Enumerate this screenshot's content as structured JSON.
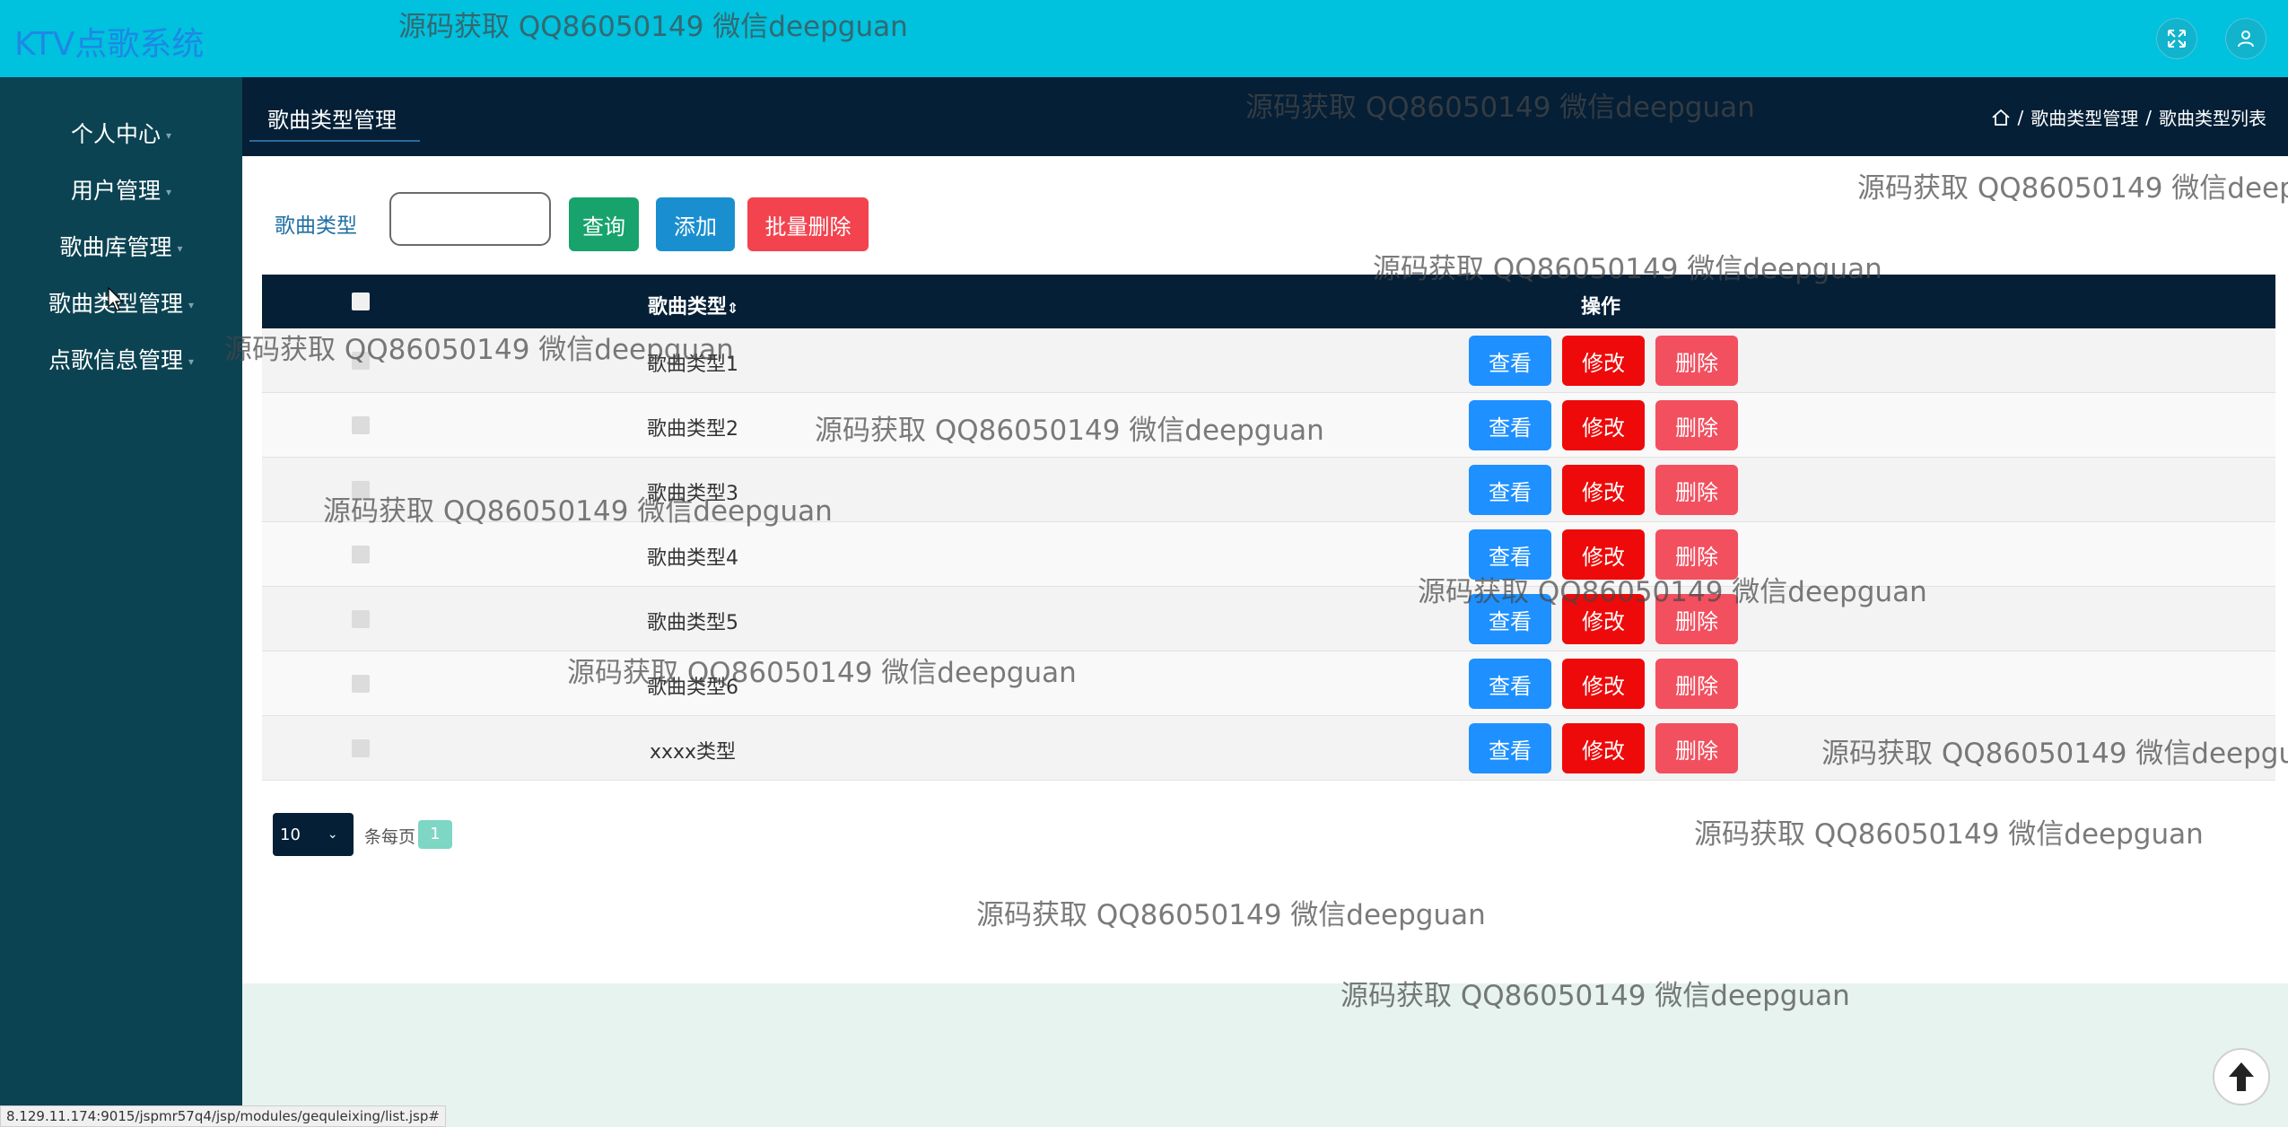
{
  "header": {
    "app_title": "KTV点歌系统",
    "fullscreen_icon": "expand-icon",
    "user_icon": "user-icon"
  },
  "sidebar": {
    "items": [
      {
        "label": "个人中心"
      },
      {
        "label": "用户管理"
      },
      {
        "label": "歌曲库管理"
      },
      {
        "label": "歌曲类型管理"
      },
      {
        "label": "点歌信息管理"
      }
    ]
  },
  "tabbar": {
    "title": "歌曲类型管理",
    "breadcrumb": [
      "歌曲类型管理",
      "歌曲类型列表"
    ],
    "home_icon": "home-icon"
  },
  "search": {
    "label": "歌曲类型",
    "value": "",
    "query_label": "查询",
    "add_label": "添加",
    "batch_delete_label": "批量删除"
  },
  "table": {
    "headers": [
      "歌曲类型",
      "操作"
    ],
    "rows": [
      {
        "name": "歌曲类型1"
      },
      {
        "name": "歌曲类型2"
      },
      {
        "name": "歌曲类型3"
      },
      {
        "name": "歌曲类型4"
      },
      {
        "name": "歌曲类型5"
      },
      {
        "name": "歌曲类型6"
      },
      {
        "name": "xxxx类型"
      }
    ],
    "actions": {
      "view": "查看",
      "edit": "修改",
      "delete": "删除"
    }
  },
  "pager": {
    "page_size": "10",
    "per_page_label": "条每页",
    "current_page": "1"
  },
  "watermark_text": "源码获取 QQ86050149 微信deepguan",
  "status_url": "8.129.11.174:9015/jspmr57q4/jsp/modules/gequleixing/list.jsp#",
  "colors": {
    "topbar": "#00c1de",
    "sidebar": "#0b4352",
    "tabbar": "#041f36",
    "query_button": "#17a36b",
    "add_button": "#1a8fd0",
    "batch_delete_button": "#f2434f",
    "view_button": "#1e90ff",
    "edit_button": "#ee0a0a",
    "delete_button": "#f24f5f"
  }
}
